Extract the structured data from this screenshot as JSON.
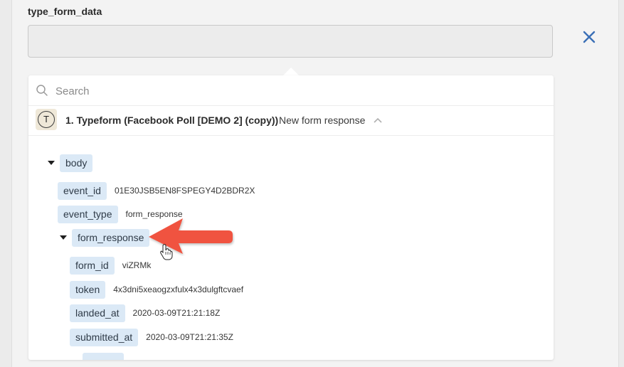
{
  "field": {
    "label": "type_form_data",
    "value": ""
  },
  "search": {
    "placeholder": "Search"
  },
  "app": {
    "icon_letter": "T",
    "title": "1. Typeform (Facebook Poll [DEMO 2] (copy))",
    "event": "New form response"
  },
  "tree": {
    "body": "body",
    "event_id_key": "event_id",
    "event_id_val": "01E30JSB5EN8FSPEGY4D2BDR2X",
    "event_type_key": "event_type",
    "event_type_val": "form_response",
    "form_response_key": "form_response",
    "form_id_key": "form_id",
    "form_id_val": "viZRMk",
    "token_key": "token",
    "token_val": "4x3dni5xeaogzxfulx4x3dulgftcvaef",
    "landed_at_key": "landed_at",
    "landed_at_val": "2020-03-09T21:21:18Z",
    "submitted_at_key": "submitted_at",
    "submitted_at_val": "2020-03-09T21:21:35Z"
  },
  "colors": {
    "pill_bg": "#dbe9f6",
    "close_blue": "#3b6fb6",
    "arrow_red": "#f0533f"
  }
}
